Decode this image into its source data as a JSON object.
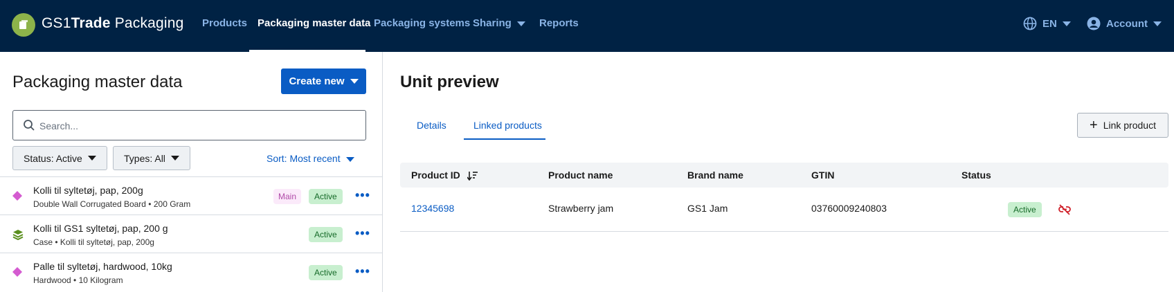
{
  "app": {
    "brand_prefix": "GS1",
    "brand_bold": "Trade",
    "brand_suffix": " Packaging"
  },
  "nav": {
    "items": [
      {
        "label": "Products",
        "active": false
      },
      {
        "label": "Packaging master data",
        "active": true
      },
      {
        "label": "Packaging systems",
        "active": false
      },
      {
        "label": "Sharing",
        "active": false
      },
      {
        "label": "Reports",
        "active": false
      }
    ],
    "language": "EN",
    "account": "Account"
  },
  "left": {
    "title": "Packaging master data",
    "create_label": "Create new",
    "search_placeholder": "Search...",
    "status_filter": "Status: Active",
    "type_filter": "Types: All",
    "sort_label": "Sort: Most recent",
    "items": [
      {
        "title": "Kolli til syltetøj, pap, 200g",
        "subtitle": "Double Wall Corrugated Board • 200 Gram",
        "main_badge": "Main",
        "status": "Active",
        "icon": "diamond-icon",
        "icon_color": "#d45bd0"
      },
      {
        "title": "Kolli til GS1 syltetøj, pap, 200 g",
        "subtitle": "Case • Kolli til syltetøj, pap, 200g",
        "status": "Active",
        "icon": "layers-icon",
        "icon_color": "#5a8f1e"
      },
      {
        "title": "Palle til syltetøj, hardwood, 10kg",
        "subtitle": "Hardwood • 10 Kilogram",
        "status": "Active",
        "icon": "diamond-icon",
        "icon_color": "#d45bd0"
      }
    ]
  },
  "right": {
    "title": "Unit preview",
    "tabs": [
      {
        "label": "Details",
        "active": false
      },
      {
        "label": "Linked products",
        "active": true
      }
    ],
    "link_button": "Link product",
    "table": {
      "headers": [
        "Product ID",
        "Product name",
        "Brand name",
        "GTIN",
        "Status"
      ],
      "rows": [
        {
          "product_id": "12345698",
          "product_name": "Strawberry jam",
          "brand_name": "GS1 Jam",
          "gtin": "03760009240803",
          "status": "Active"
        }
      ]
    }
  },
  "colors": {
    "navbar": "#002244",
    "primary": "#0a5cc4",
    "active_badge_bg": "#c8efcf",
    "main_badge_bg": "#fbeafa",
    "unlink_red": "#d0202a"
  }
}
